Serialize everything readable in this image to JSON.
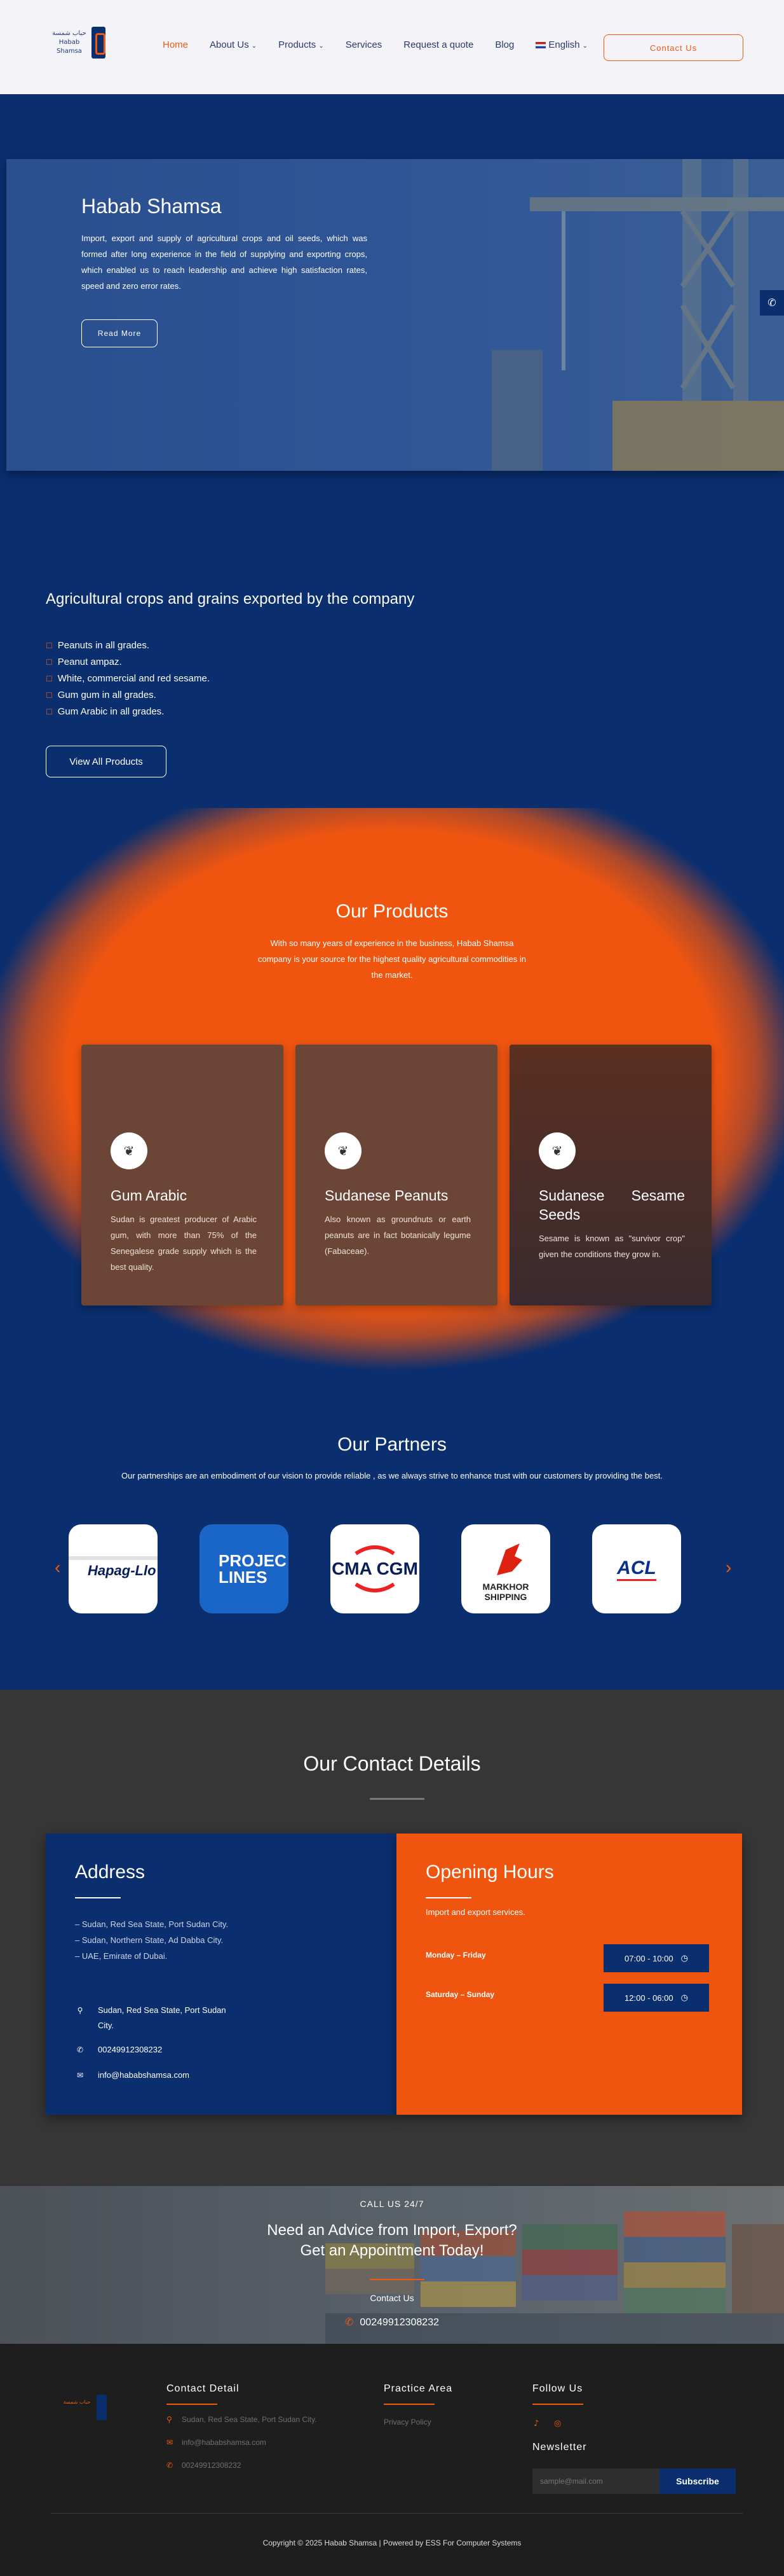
{
  "header": {
    "logo_text": "حباب شمسة\nHabab Shamsa",
    "nav": [
      {
        "label": "Home",
        "active": true,
        "has_dropdown": false
      },
      {
        "label": "About Us",
        "active": false,
        "has_dropdown": true
      },
      {
        "label": "Products",
        "active": false,
        "has_dropdown": true
      },
      {
        "label": "Services",
        "active": false,
        "has_dropdown": false
      },
      {
        "label": "Request a quote",
        "active": false,
        "has_dropdown": false
      },
      {
        "label": "Blog",
        "active": false,
        "has_dropdown": false
      },
      {
        "label": "English",
        "active": false,
        "has_dropdown": true
      }
    ],
    "contact_button": "Contact Us"
  },
  "hero": {
    "title": "Habab Shamsa",
    "description": "Import, export and supply of agricultural crops and oil seeds, which was formed after long experience in the field of supplying and exporting crops, which enabled us to reach leadership and achieve high satisfaction rates, speed and zero error rates.",
    "button": "Read More"
  },
  "side_phone_icon": "phone-icon",
  "crops": {
    "title": "Agricultural crops and grains exported by the company",
    "items": [
      "Peanuts in all grades.",
      "Peanut ampaz.",
      "White, commercial and red sesame.",
      "Gum gum in all grades.",
      "Gum Arabic in all grades."
    ],
    "button": "View All Products"
  },
  "products": {
    "title": "Our Products",
    "subtitle": "With so many years of experience in the business, Habab Shamsa company is your source for the highest quality agricultural commodities in the market.",
    "cards": [
      {
        "title": "Gum Arabic",
        "text": "Sudan is greatest producer of Arabic gum, with more than 75% of the Senegalese grade supply which is the best quality.",
        "icon": "leaf-icon"
      },
      {
        "title": "Sudanese Peanuts",
        "text": "Also known as groundnuts or earth peanuts are in fact botanically legume (Fabaceae).",
        "icon": "leaf-icon"
      },
      {
        "title": "Sudanese Sesame Seeds",
        "text": "Sesame is known as \"survivor crop\" given the conditions they grow in.",
        "icon": "leaf-icon"
      }
    ]
  },
  "partners": {
    "title": "Our Partners",
    "subtitle": "Our partnerships are an embodiment of our vision to provide reliable , as we always strive to enhance trust with our customers by providing the best.",
    "logos": [
      "Hapag-Llo",
      "PROJEC LINES",
      "CMA CGM",
      "MARKHOR SHIPPING",
      "ACL"
    ],
    "prev_icon": "chevron-left-icon",
    "next_icon": "chevron-right-icon"
  },
  "contact": {
    "title": "Our Contact Details",
    "address_title": "Address",
    "address_lines": [
      "– Sudan, Red Sea State, Port Sudan City.",
      "– Sudan, Northern State, Ad Dabba City.",
      "– UAE, Emirate of Dubai."
    ],
    "location": "Sudan, Red Sea State, Port Sudan City.",
    "phone": "00249912308232",
    "email": "info@hababshamsa.com",
    "hours_title": "Opening Hours",
    "hours_desc": "Import and export services.",
    "hours": [
      {
        "days": "Monday – Friday",
        "time": "07:00 - 10:00"
      },
      {
        "days": "Saturday – Sunday",
        "time": "12:00 - 06:00"
      }
    ]
  },
  "call": {
    "label": "CALL US 24/7",
    "headline_1": "Need an Advice from Import, Export?",
    "headline_2": "Get an Appointment Today!",
    "contact_link": "Contact Us",
    "phone": "00249912308232"
  },
  "footer": {
    "logo_text": "حباب شمسة",
    "contact_title": "Contact Detail",
    "contact_location": "Sudan, Red Sea State, Port Sudan City.",
    "contact_email": "info@hababshamsa.com",
    "contact_phone": "00249912308232",
    "practice_title": "Practice Area",
    "practice_link": "Privacy Policy",
    "follow_title": "Follow Us",
    "newsletter_title": "Newsletter",
    "newsletter_placeholder": "sample@mail.com",
    "subscribe": "Subscribe",
    "copyright": "Copyright © 2025 Habab Shamsa | Powered by ESS For Computer Systems"
  },
  "colors": {
    "navy": "#0a2e6e",
    "orange": "#ee5b10",
    "dark": "#1e1e1e"
  }
}
